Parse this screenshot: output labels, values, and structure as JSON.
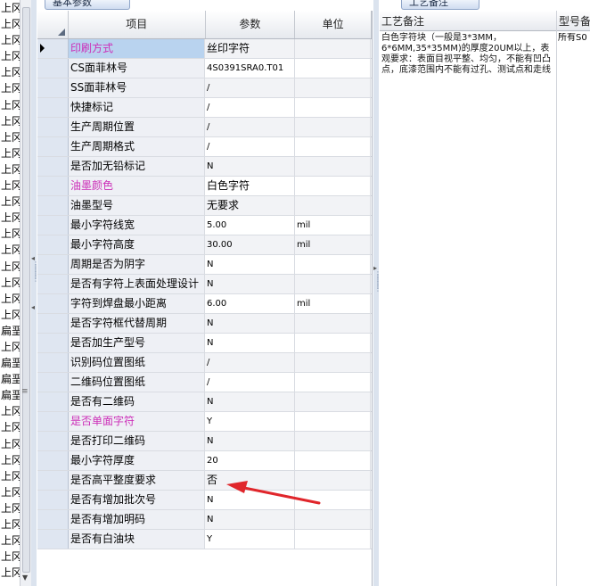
{
  "left_list": [
    "上冈",
    "上冈",
    "上冈",
    "上冈",
    "上冈",
    "上冈",
    "上冈",
    "上冈",
    "上冈",
    "上冈",
    "上冈",
    "上冈",
    "上冈",
    "上冈",
    "上冈",
    "上冈",
    "上冈",
    "上冈",
    "上冈",
    "上冈",
    "扁垩",
    "上冈",
    "扁垩",
    "扁垩",
    "扁垩",
    "上冈",
    "上冈",
    "上冈",
    "上冈",
    "上冈",
    "上冈",
    "上冈",
    "上冈",
    "上冈",
    "上冈",
    "上冈"
  ],
  "tabs": {
    "basic_params": "基本参数",
    "process_notes": "工艺备注"
  },
  "grid": {
    "columns": {
      "item": "项目",
      "param": "参数",
      "unit": "单位"
    },
    "rows": [
      {
        "item": "印刷方式",
        "value": "丝印字符",
        "unit": "",
        "pink": true,
        "cn": true
      },
      {
        "item": "CS面菲林号",
        "value": "4S0391SRA0.T01",
        "unit": ""
      },
      {
        "item": "SS面菲林号",
        "value": "/",
        "unit": ""
      },
      {
        "item": "快捷标记",
        "value": "/",
        "unit": ""
      },
      {
        "item": "生产周期位置",
        "value": "/",
        "unit": ""
      },
      {
        "item": "生产周期格式",
        "value": "/",
        "unit": ""
      },
      {
        "item": "是否加无铅标记",
        "value": "N",
        "unit": ""
      },
      {
        "item": "油墨颜色",
        "value": "白色字符",
        "unit": "",
        "pink": true,
        "cn": true
      },
      {
        "item": "油墨型号",
        "value": "无要求",
        "unit": "",
        "cn": true
      },
      {
        "item": "最小字符线宽",
        "value": "5.00",
        "unit": "mil"
      },
      {
        "item": "最小字符高度",
        "value": "30.00",
        "unit": "mil"
      },
      {
        "item": "周期是否为阴字",
        "value": "N",
        "unit": ""
      },
      {
        "item": "是否有字符上表面处理设计",
        "value": "N",
        "unit": ""
      },
      {
        "item": "字符到焊盘最小距离",
        "value": "6.00",
        "unit": "mil"
      },
      {
        "item": "是否字符框代替周期",
        "value": "N",
        "unit": ""
      },
      {
        "item": "是否加生产型号",
        "value": "N",
        "unit": ""
      },
      {
        "item": "识别码位置图纸",
        "value": "/",
        "unit": ""
      },
      {
        "item": "二维码位置图纸",
        "value": "/",
        "unit": ""
      },
      {
        "item": "是否有二维码",
        "value": "N",
        "unit": ""
      },
      {
        "item": "是否单面字符",
        "value": "Y",
        "unit": "",
        "pink": true
      },
      {
        "item": "是否打印二维码",
        "value": "N",
        "unit": ""
      },
      {
        "item": "最小字符厚度",
        "value": "20",
        "unit": ""
      },
      {
        "item": "是否高平整度要求",
        "value": "否",
        "unit": "",
        "cn": true
      },
      {
        "item": "是否有增加批次号",
        "value": "N",
        "unit": ""
      },
      {
        "item": "是否有增加明码",
        "value": "N",
        "unit": ""
      },
      {
        "item": "是否有白油块",
        "value": "Y",
        "unit": ""
      }
    ]
  },
  "panel": {
    "col1": "工艺备注",
    "col2": "型号备",
    "remark": "白色字符块（一般是3*3MM，6*6MM,35*35MM)的厚度20UM以上，表观要求：表面目视平整、均匀，不能有凹凸点，底漆范围内不能有过孔、测试点和走线",
    "remark2": "所有S0"
  },
  "colors": {
    "pink_label": "#cc2eb8",
    "arrow": "#e0262b",
    "selected_row": "#b9d3ef"
  }
}
